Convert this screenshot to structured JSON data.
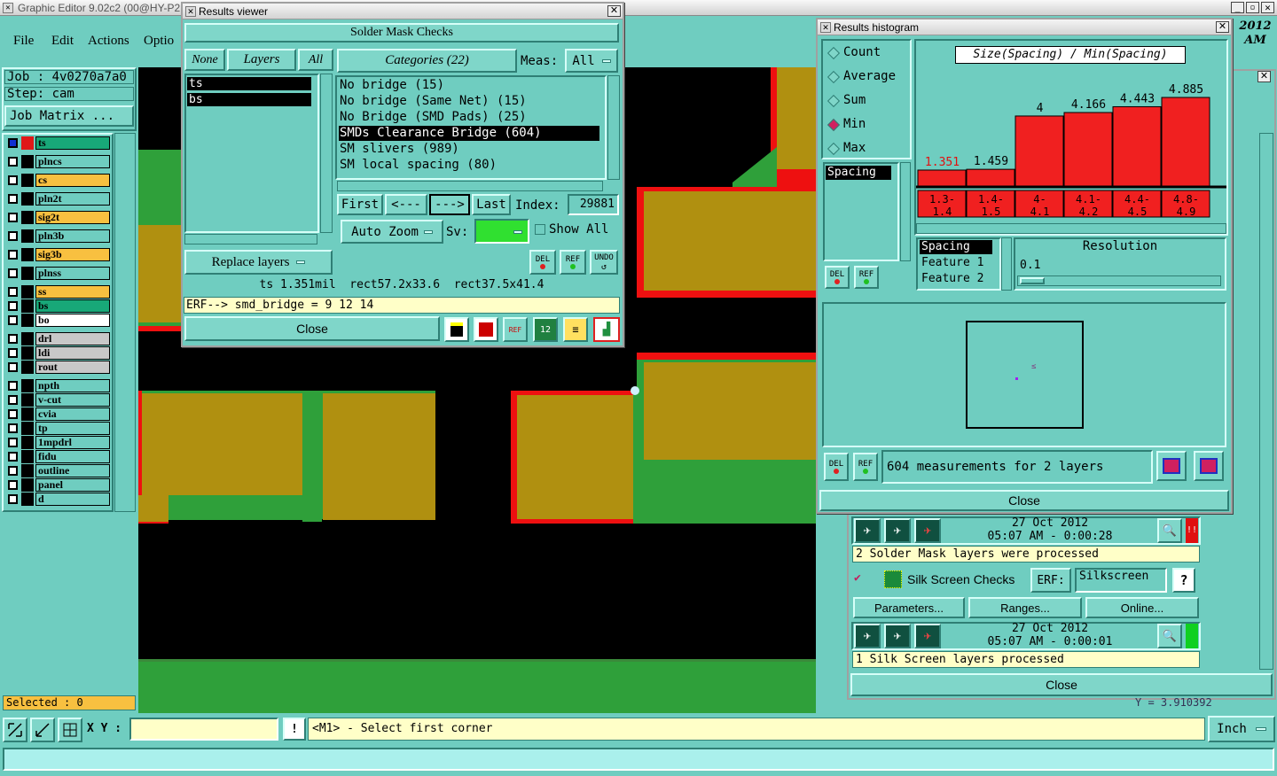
{
  "app": {
    "title": "Graphic Editor 9.02c2 (00@HY-P2",
    "date_right": "2012",
    "time_right": "AM",
    "menu": [
      "File",
      "Edit",
      "Actions",
      "Optio"
    ]
  },
  "left": {
    "job": "Job : 4v0270a7a0",
    "step": "Step: cam",
    "job_matrix": "Job Matrix ...",
    "selected": "Selected : 0",
    "layers": [
      {
        "name": "ts",
        "color": "#18a878"
      },
      {
        "name": "plncs",
        "color": "#6fcdc0"
      },
      {
        "name": "cs",
        "color": "#f8c040"
      },
      {
        "name": "pln2t",
        "color": "#6fcdc0"
      },
      {
        "name": "sig2t",
        "color": "#f8c040"
      },
      {
        "name": "pln3b",
        "color": "#6fcdc0"
      },
      {
        "name": "sig3b",
        "color": "#f8c040"
      },
      {
        "name": "plnss",
        "color": "#6fcdc0"
      },
      {
        "name": "ss",
        "color": "#f8c040"
      },
      {
        "name": "bs",
        "color": "#18a878"
      },
      {
        "name": "bo",
        "color": "#ffffff"
      },
      {
        "name": "drl",
        "color": "#c8c8c8"
      },
      {
        "name": "ldi",
        "color": "#c8c8c8"
      },
      {
        "name": "rout",
        "color": "#c8c8c8"
      },
      {
        "name": "npth",
        "color": "#6fcdc0"
      },
      {
        "name": "v-cut",
        "color": "#6fcdc0"
      },
      {
        "name": "cvia",
        "color": "#6fcdc0"
      },
      {
        "name": "tp",
        "color": "#6fcdc0"
      },
      {
        "name": "1mpdrl",
        "color": "#6fcdc0"
      },
      {
        "name": "fidu",
        "color": "#6fcdc0"
      },
      {
        "name": "outline",
        "color": "#6fcdc0"
      },
      {
        "name": "panel",
        "color": "#6fcdc0"
      },
      {
        "name": "d",
        "color": "#6fcdc0"
      }
    ]
  },
  "bottom": {
    "xy_label": "X Y :",
    "xy_value": "",
    "message": "<M1> - Select first corner",
    "units": "Inch",
    "coord": "Y = 3.910392"
  },
  "results_viewer": {
    "title": "Results viewer",
    "header": "Solder Mask Checks",
    "none": "None",
    "layers_btn": "Layers",
    "all": "All",
    "layers": [
      "ts",
      "bs"
    ],
    "categories_btn": "Categories (22)",
    "meas_label": "Meas:",
    "meas_value": "All",
    "categories": [
      "No bridge (15)",
      "No bridge (Same Net) (15)",
      "No Bridge (SMD Pads) (25)",
      "SMDs Clearance Bridge (604)",
      "SM slivers (989)",
      "SM local spacing (80)"
    ],
    "first": "First",
    "prev": "<---",
    "next": "--->",
    "last": "Last",
    "index_label": "Index:",
    "index_value": "29881",
    "auto_zoom": "Auto Zoom",
    "sv_label": "Sv:",
    "show_all": "Show All",
    "replace_layers": "Replace layers",
    "del": "DEL",
    "ref": "REF",
    "undo": "UNDO",
    "measure": "ts 1.351mil  rect57.2x33.6  rect37.5x41.4",
    "erf": "ERF--> smd_bridge = 9 12 14",
    "close": "Close"
  },
  "histogram": {
    "title": "Results histogram",
    "modes": [
      "Count",
      "Average",
      "Sum",
      "Min",
      "Max"
    ],
    "selected_mode": "Min",
    "heading": "Size(Spacing) / Min(Spacing)",
    "list_item": "Spacing",
    "del": "DEL",
    "ref": "REF",
    "features": [
      "Spacing",
      "Feature 1",
      "Feature 2"
    ],
    "resolution_label": "Resolution",
    "resolution_value": "0.1",
    "summary": "604 measurements for 2 layers",
    "close": "Close",
    "marker": "≤"
  },
  "chart_data": {
    "type": "bar",
    "title": "Size(Spacing) / Min(Spacing)",
    "categories": [
      "1.3-1.4",
      "1.4-1.5",
      "4-4.1",
      "4.1-4.2",
      "4.4-4.5",
      "4.8-4.9"
    ],
    "range_top": [
      "1.3-",
      "1.4-",
      "4-",
      "4.1-",
      "4.4-",
      "4.8-"
    ],
    "range_bottom": [
      "1.4",
      "1.5",
      "4.1",
      "4.2",
      "4.5",
      "4.9"
    ],
    "values": [
      1.351,
      1.459,
      4,
      4.166,
      4.443,
      4.885
    ],
    "value_labels": [
      "1.351",
      "1.459",
      "4",
      "4.166",
      "4.443",
      "4.885"
    ],
    "ylim": [
      0,
      4.885
    ],
    "bar_color": "#f02020",
    "highlight_color": "#e01010"
  },
  "checks": {
    "sm_date": "27 Oct 2012",
    "sm_time": "05:07 AM - 0:00:28",
    "sm_status": "2 Solder Mask layers were processed",
    "ss_name": "Silk Screen Checks",
    "erf_label": "ERF:",
    "erf_value": "Silkscreen",
    "help": "?",
    "parameters": "Parameters...",
    "ranges": "Ranges...",
    "online": "Online...",
    "ss_date": "27 Oct 2012",
    "ss_time": "05:07 AM - 0:00:01",
    "ss_status": "1 Silk Screen layers processed",
    "close": "Close",
    "flag": "!!"
  }
}
